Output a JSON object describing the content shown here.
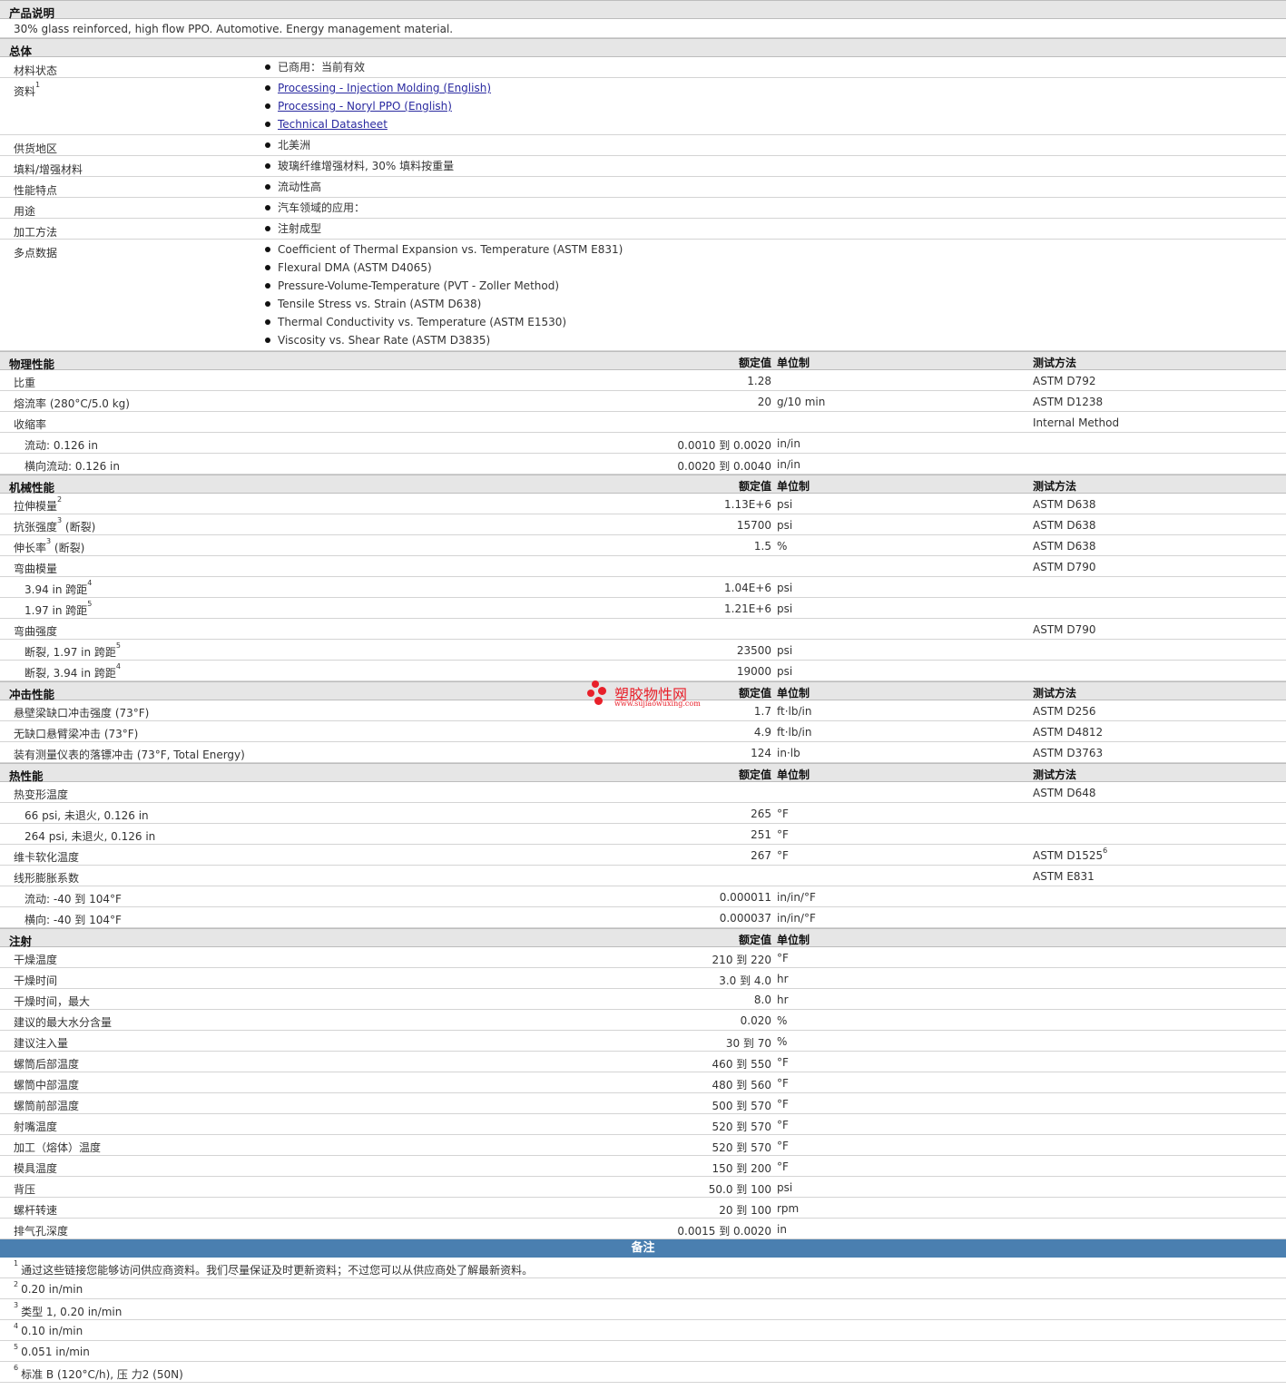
{
  "product_description": {
    "title": "产品说明",
    "text": "30% glass reinforced, high flow PPO. Automotive. Energy management material."
  },
  "general": {
    "title": "总体",
    "rows": [
      {
        "label": "材料状态",
        "items": [
          {
            "text": "已商用：当前有效"
          }
        ]
      },
      {
        "label": "资料",
        "sup": "1",
        "items": [
          {
            "text": "Processing - Injection Molding (English)",
            "link": true
          },
          {
            "text": "Processing - Noryl PPO (English)",
            "link": true
          },
          {
            "text": "Technical Datasheet",
            "link": true
          }
        ]
      },
      {
        "label": "供货地区",
        "items": [
          {
            "text": "北美洲"
          }
        ]
      },
      {
        "label": "填料/增强材料",
        "items": [
          {
            "text": "玻璃纤维增强材料, 30% 填料按重量"
          }
        ]
      },
      {
        "label": "性能特点",
        "items": [
          {
            "text": "流动性高"
          }
        ]
      },
      {
        "label": "用途",
        "items": [
          {
            "text": "汽车领域的应用："
          }
        ]
      },
      {
        "label": "加工方法",
        "items": [
          {
            "text": "注射成型"
          }
        ]
      },
      {
        "label": "多点数据",
        "items": [
          {
            "text": "Coefficient of Thermal Expansion vs. Temperature (ASTM E831)"
          },
          {
            "text": "Flexural DMA (ASTM D4065)"
          },
          {
            "text": "Pressure-Volume-Temperature (PVT - Zoller Method)"
          },
          {
            "text": "Tensile Stress vs. Strain (ASTM D638)"
          },
          {
            "text": "Thermal Conductivity vs. Temperature (ASTM E1530)"
          },
          {
            "text": "Viscosity vs. Shear Rate (ASTM D3835)"
          }
        ]
      }
    ]
  },
  "column_headers": {
    "value": "额定值",
    "unit": "单位制",
    "method": "测试方法"
  },
  "sections": [
    {
      "title": "物理性能",
      "has_method": true,
      "rows": [
        {
          "label": "比重",
          "value": "1.28",
          "unit": "",
          "method": "ASTM D792"
        },
        {
          "label": "熔流率  (280°C/5.0 kg)",
          "value": "20",
          "unit": "g/10 min",
          "method": "ASTM D1238"
        },
        {
          "label": "收缩率",
          "value": "",
          "unit": "",
          "method": "Internal Method"
        },
        {
          "label": "流动: 0.126 in",
          "sub": true,
          "value": "0.0010 到  0.0020",
          "unit": "in/in",
          "method": ""
        },
        {
          "label": "横向流动: 0.126 in",
          "sub": true,
          "value": "0.0020 到  0.0040",
          "unit": "in/in",
          "method": ""
        }
      ]
    },
    {
      "title": "机械性能",
      "has_method": true,
      "rows": [
        {
          "label": "拉伸模量",
          "sup": "2",
          "value": "1.13E+6",
          "unit": "psi",
          "method": "ASTM D638"
        },
        {
          "label": "抗张强度",
          "sup": "3",
          "suffix": " (断裂)",
          "value": "15700",
          "unit": "psi",
          "method": "ASTM D638"
        },
        {
          "label": "伸长率",
          "sup": "3",
          "suffix": " (断裂)",
          "value": "1.5",
          "unit": "%",
          "method": "ASTM D638"
        },
        {
          "label": "弯曲模量",
          "value": "",
          "unit": "",
          "method": "ASTM D790"
        },
        {
          "label": "3.94 in 跨距",
          "sub": true,
          "sup": "4",
          "value": "1.04E+6",
          "unit": "psi",
          "method": ""
        },
        {
          "label": "1.97 in 跨距",
          "sub": true,
          "sup": "5",
          "value": "1.21E+6",
          "unit": "psi",
          "method": ""
        },
        {
          "label": "弯曲强度",
          "value": "",
          "unit": "",
          "method": "ASTM D790"
        },
        {
          "label": "断裂, 1.97 in 跨距",
          "sub": true,
          "sup": "5",
          "value": "23500",
          "unit": "psi",
          "method": ""
        },
        {
          "label": "断裂, 3.94 in 跨距",
          "sub": true,
          "sup": "4",
          "value": "19000",
          "unit": "psi",
          "method": ""
        }
      ]
    },
    {
      "title": "冲击性能",
      "has_method": true,
      "rows": [
        {
          "label": "悬壁梁缺口冲击强度  (73°F)",
          "value": "1.7",
          "unit": "ft·lb/in",
          "method": "ASTM D256"
        },
        {
          "label": "无缺口悬臂梁冲击  (73°F)",
          "value": "4.9",
          "unit": "ft·lb/in",
          "method": "ASTM D4812"
        },
        {
          "label": "装有测量仪表的落镖冲击  (73°F, Total Energy)",
          "value": "124",
          "unit": "in·lb",
          "method": "ASTM D3763"
        }
      ]
    },
    {
      "title": "热性能",
      "has_method": true,
      "rows": [
        {
          "label": "热变形温度",
          "value": "",
          "unit": "",
          "method": "ASTM D648"
        },
        {
          "label": "66 psi, 未退火, 0.126 in",
          "sub": true,
          "value": "265",
          "unit": "°F",
          "method": ""
        },
        {
          "label": "264 psi, 未退火, 0.126 in",
          "sub": true,
          "value": "251",
          "unit": "°F",
          "method": ""
        },
        {
          "label": "维卡软化温度",
          "value": "267",
          "unit": "°F",
          "method": "ASTM D1525",
          "method_sup": "6"
        },
        {
          "label": "线形膨胀系数",
          "value": "",
          "unit": "",
          "method": "ASTM E831"
        },
        {
          "label": "流动: -40 到  104°F",
          "sub": true,
          "value": "0.000011",
          "unit": "in/in/°F",
          "method": ""
        },
        {
          "label": "横向: -40 到  104°F",
          "sub": true,
          "value": "0.000037",
          "unit": "in/in/°F",
          "method": ""
        }
      ]
    },
    {
      "title": "注射",
      "has_method": false,
      "rows": [
        {
          "label": "干燥温度",
          "value": "210 到  220",
          "unit": "°F",
          "method": ""
        },
        {
          "label": "干燥时间",
          "value": "3.0 到  4.0",
          "unit": "hr",
          "method": ""
        },
        {
          "label": "干燥时间，最大",
          "value": "8.0",
          "unit": "hr",
          "method": ""
        },
        {
          "label": "建议的最大水分含量",
          "value": "0.020",
          "unit": "%",
          "method": ""
        },
        {
          "label": "建议注入量",
          "value": "30 到  70",
          "unit": "%",
          "method": ""
        },
        {
          "label": "螺筒后部温度",
          "value": "460 到  550",
          "unit": "°F",
          "method": ""
        },
        {
          "label": "螺筒中部温度",
          "value": "480 到  560",
          "unit": "°F",
          "method": ""
        },
        {
          "label": "螺筒前部温度",
          "value": "500 到  570",
          "unit": "°F",
          "method": ""
        },
        {
          "label": "射嘴温度",
          "value": "520 到  570",
          "unit": "°F",
          "method": ""
        },
        {
          "label": "加工（熔体）温度",
          "value": "520 到  570",
          "unit": "°F",
          "method": ""
        },
        {
          "label": "模具温度",
          "value": "150 到  200",
          "unit": "°F",
          "method": ""
        },
        {
          "label": "背压",
          "value": "50.0 到  100",
          "unit": "psi",
          "method": ""
        },
        {
          "label": "螺杆转速",
          "value": "20 到  100",
          "unit": "rpm",
          "method": ""
        },
        {
          "label": "排气孔深度",
          "value": "0.0015 到  0.0020",
          "unit": "in",
          "method": ""
        }
      ]
    }
  ],
  "notes": {
    "title": "备注",
    "items": [
      {
        "num": "1",
        "text": "通过这些链接您能够访问供应商资料。我们尽量保证及时更新资料；不过您可以从供应商处了解最新资料。"
      },
      {
        "num": "2",
        "text": "0.20 in/min"
      },
      {
        "num": "3",
        "text": "类型  1, 0.20 in/min"
      },
      {
        "num": "4",
        "text": "0.10 in/min"
      },
      {
        "num": "5",
        "text": "0.051 in/min"
      },
      {
        "num": "6",
        "text": "标准  B (120°C/h), 压  力2 (50N)"
      }
    ]
  },
  "watermark": {
    "name": "塑胶物性网",
    "url": "www.sujiaowuxing.com"
  },
  "colors": {
    "section_bg": "#e6e6e6",
    "notes_bg": "#4a7fb0",
    "link": "#2a2aa0",
    "watermark": "#e8202a"
  }
}
